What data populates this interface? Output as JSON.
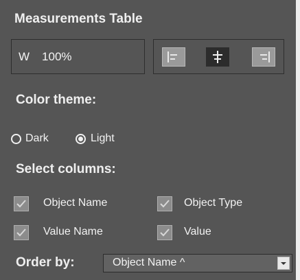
{
  "panel": {
    "title": "Measurements Table",
    "width": {
      "prefix": "W",
      "value": "100%"
    },
    "alignment": {
      "options": [
        "left",
        "center",
        "right"
      ],
      "selected": "center"
    },
    "color_theme": {
      "title": "Color theme:",
      "options": [
        {
          "label": "Dark",
          "checked": false
        },
        {
          "label": "Light",
          "checked": true
        }
      ]
    },
    "columns": {
      "title": "Select columns:",
      "items": [
        {
          "label": "Object Name",
          "checked": true
        },
        {
          "label": "Object Type",
          "checked": true
        },
        {
          "label": "Value Name",
          "checked": true
        },
        {
          "label": "Value",
          "checked": true
        }
      ]
    },
    "order_by": {
      "label": "Order by:",
      "value": "Object Name ^"
    }
  },
  "colors": {
    "panel_bg": "#555555",
    "border": "#2d2d2d",
    "selected_button": "#2c2c2c",
    "unselected_button": "#9a9a9a"
  }
}
